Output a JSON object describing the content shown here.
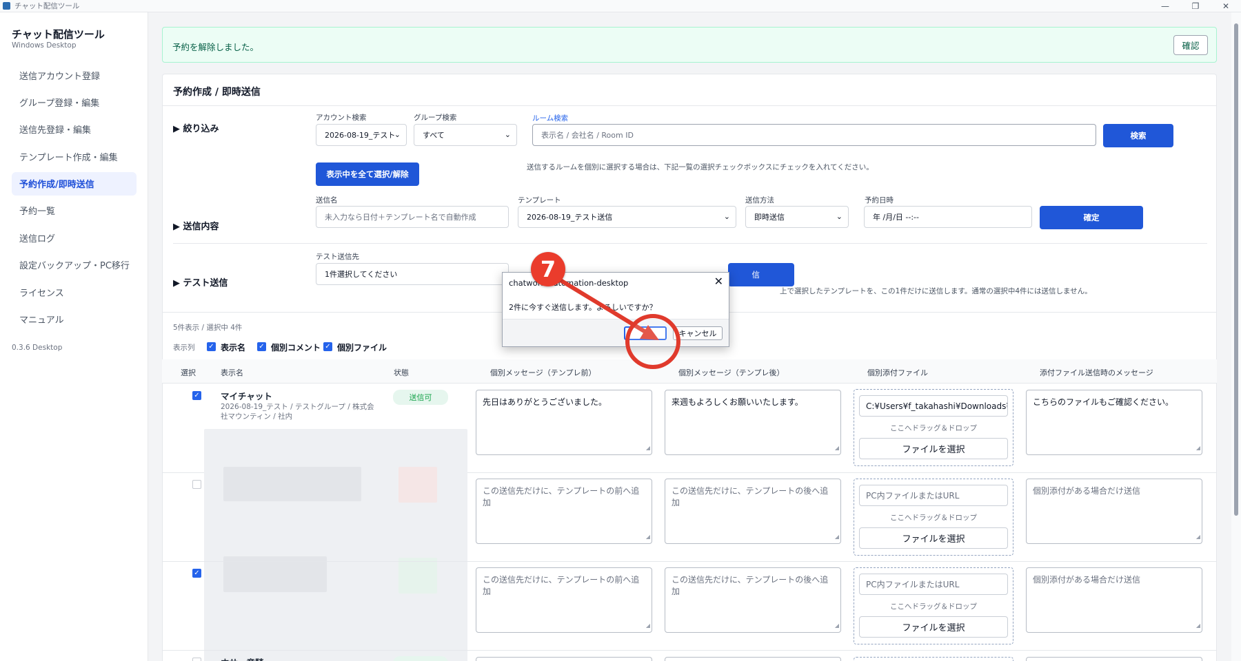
{
  "window": {
    "title": "チャット配信ツール",
    "controls": [
      "—",
      "❐",
      "✕"
    ]
  },
  "sidebar": {
    "brand": "チャット配信ツール",
    "subtitle": "Windows Desktop",
    "items": [
      {
        "label": "送信アカウント登録"
      },
      {
        "label": "グループ登録・編集"
      },
      {
        "label": "送信先登録・編集"
      },
      {
        "label": "テンプレート作成・編集"
      },
      {
        "label": "予約作成/即時送信",
        "active": true
      },
      {
        "label": "予約一覧"
      },
      {
        "label": "送信ログ"
      },
      {
        "label": "設定バックアップ・PC移行"
      },
      {
        "label": "ライセンス"
      },
      {
        "label": "マニュアル"
      }
    ],
    "version": "0.3.6 Desktop"
  },
  "alert": {
    "message": "予約を解除しました。",
    "button": "確認"
  },
  "panel": {
    "title": "予約作成 / 即時送信",
    "filter": {
      "section": "▶ 絞り込み",
      "account_label": "アカウント検索",
      "account_value": "2026-08-19_テスト",
      "group_label": "グループ検索",
      "group_value": "すべて",
      "room_label": "ルーム検索",
      "room_placeholder": "表示名 / 会社名 / Room ID",
      "search_button": "検索",
      "select_all_button": "表示中を全て選択/解除",
      "hint": "送信するルームを個別に選択する場合は、下記一覧の選択チェックボックスにチェックを入れてください。"
    },
    "content": {
      "section": "▶ 送信内容",
      "name_label": "送信名",
      "name_placeholder": "未入力なら日付＋テンプレート名で自動作成",
      "template_label": "テンプレート",
      "template_value": "2026-08-19_テスト送信",
      "method_label": "送信方法",
      "method_value": "即時送信",
      "schedule_label": "予約日時",
      "schedule_value": "年 /月/日 --:--",
      "confirm_button": "確定"
    },
    "test": {
      "section": "▶ テスト送信",
      "dest_label": "テスト送信先",
      "dest_value": "1件選択してください",
      "send_button_tail": "信",
      "hint": "上で選択したテンプレートを、この1件だけに送信します。通常の選択中4件には送信しません。"
    },
    "summary": "5件表示 / 選択中 4件",
    "columns_toggle": {
      "label": "表示列",
      "items": [
        "表示名",
        "個別コメント",
        "個別ファイル"
      ]
    },
    "table": {
      "headers": [
        "選択",
        "表示名",
        "状態",
        "個別メッセージ（テンプレ前）",
        "個別メッセージ（テンプレ後）",
        "個別添付ファイル",
        "添付ファイル送信時のメッセージ"
      ],
      "rows": [
        {
          "checked": true,
          "name": "マイチャット",
          "meta": "2026-08-19_テスト / テストグループ / 株式会社マウンティン / 社内",
          "status": "送信可",
          "msg_before": "先日はありがとうございました。",
          "msg_after": "来週もよろしくお願いいたします。",
          "file": "C:¥Users¥f_takahashi¥Downloads¥",
          "file_msg": "こちらのファイルもご確認ください。"
        },
        {
          "checked": false,
          "msg_before_placeholder": "この送信先だけに、テンプレートの前へ追加",
          "msg_after_placeholder": "この送信先だけに、テンプレートの後へ追加",
          "file_placeholder": "PC内ファイルまたはURL",
          "file_msg_placeholder": "個別添付がある場合だけ送信"
        },
        {
          "checked": true,
          "msg_before_placeholder": "この送信先だけに、テンプレートの前へ追加",
          "msg_after_placeholder": "この送信先だけに、テンプレートの後へ追加",
          "file_placeholder": "PC内ファイルまたはURL",
          "file_msg_placeholder": "個別添付がある場合だけ送信"
        },
        {
          "checked": false,
          "name_partial": "ホサ　竜騎"
        }
      ],
      "drop_hint": "ここへドラッグ＆ドロップ",
      "pick_button": "ファイルを選択"
    }
  },
  "dialog": {
    "title": "chatwork-automation-desktop",
    "message": "2件に今すぐ送信します。よろしいですか？",
    "ok": "",
    "cancel": "キャンセル"
  },
  "annotation": {
    "step": "7"
  },
  "colors": {
    "primary": "#2057d8",
    "success_bg": "#ecfdf5",
    "annotation": "#ea3c2c"
  }
}
